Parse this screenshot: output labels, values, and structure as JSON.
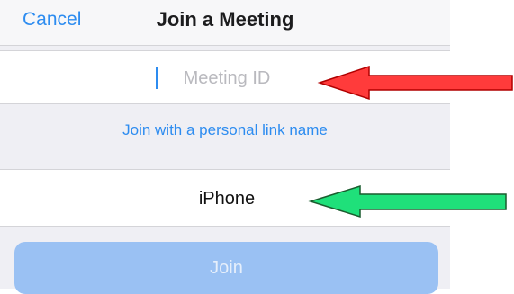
{
  "header": {
    "cancel_label": "Cancel",
    "title": "Join a Meeting"
  },
  "meeting_id": {
    "value": "",
    "placeholder": "Meeting ID"
  },
  "personal_link_label": "Join with a personal link name",
  "display_name": {
    "value": "iPhone"
  },
  "join_label": "Join",
  "annotations": [
    {
      "name": "red-arrow",
      "color": "#ff3b3b",
      "stroke": "#b00000",
      "points_to": "meeting-id-input"
    },
    {
      "name": "green-arrow",
      "color": "#1fe07a",
      "stroke": "#1a5c2e",
      "points_to": "display-name-input"
    }
  ],
  "colors": {
    "accent": "#2d8cf0",
    "background": "#efeff4",
    "join_disabled": "#9ac1f3"
  }
}
